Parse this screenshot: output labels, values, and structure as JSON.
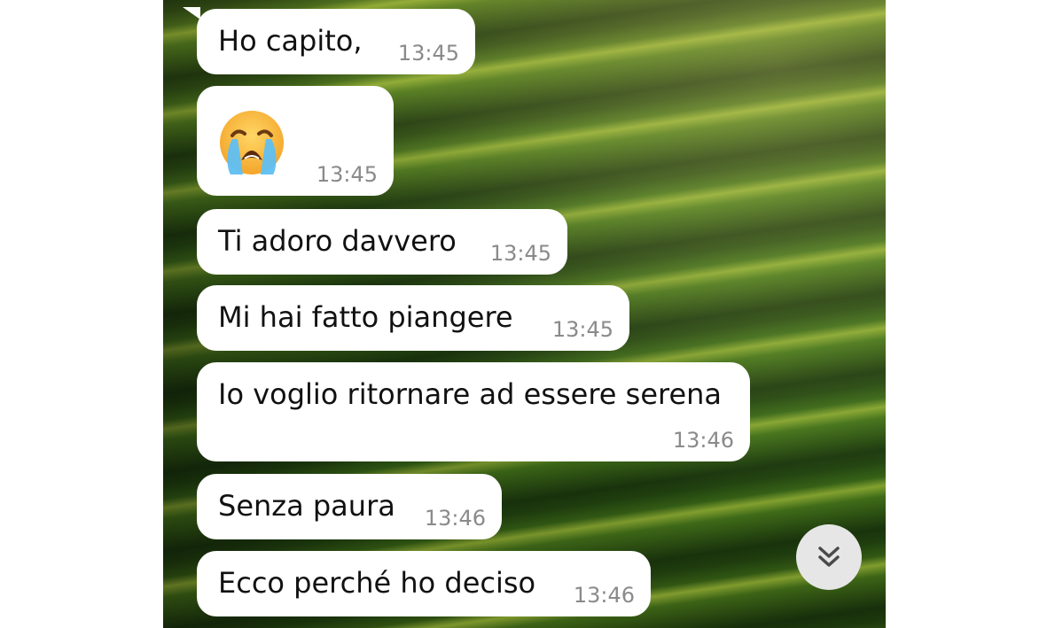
{
  "messages": [
    {
      "text": "Ho capito,",
      "time": "13:45"
    },
    {
      "emoji_icon": "loudly-crying-face-icon",
      "time": "13:45"
    },
    {
      "text": "Ti adoro davvero",
      "time": "13:45"
    },
    {
      "text": "Mi hai fatto piangere",
      "time": "13:45"
    },
    {
      "text": "Io voglio ritornare ad essere serena",
      "time": "13:46"
    },
    {
      "text": "Senza paura",
      "time": "13:46"
    },
    {
      "text": "Ecco perché ho deciso",
      "time": "13:46"
    }
  ],
  "scroll_button": {
    "icon": "double-chevron-down-icon"
  },
  "colors": {
    "bubble_bg": "#ffffff",
    "timestamp": "#8a8a8a",
    "scroll_button_bg": "#e6e6e6",
    "scroll_button_icon": "#4a4a4a"
  }
}
